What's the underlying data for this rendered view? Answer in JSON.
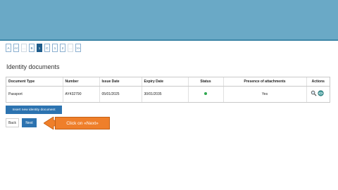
{
  "pager": {
    "items": [
      "A",
      "<<",
      "...",
      "B",
      "1",
      "C",
      "1",
      "2",
      "...",
      ">>"
    ],
    "active_index": 4
  },
  "section": {
    "title": "Identity documents"
  },
  "table": {
    "headers": [
      "Document Type",
      "Number",
      "Issue Date",
      "Expiry Date",
      "Status",
      "Presence of attachments",
      "Actions"
    ],
    "rows": [
      {
        "document_type": "Passport",
        "number": "AY432790",
        "issue_date": "05/01/2025",
        "expiry_date": "30/01/2035",
        "status_color": "#2fa84f",
        "attachments": "Yes"
      }
    ]
  },
  "buttons": {
    "insert_label": "Insert new identity document",
    "back_label": "Back",
    "next_label": "Next"
  },
  "callout": {
    "text": "Click on «Next»",
    "color": "#ef7f2a"
  },
  "colors": {
    "header_band": "#6aa9c6",
    "primary": "#2c73b0"
  }
}
